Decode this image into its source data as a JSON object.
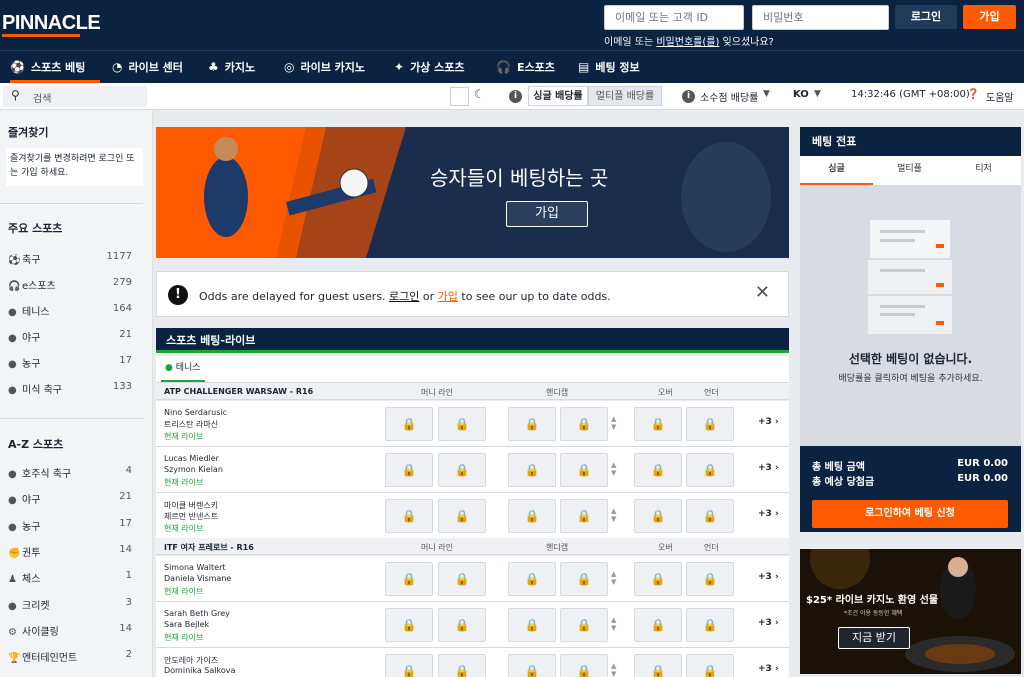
{
  "header": {
    "logo": "PINNACLE",
    "email_placeholder": "이메일 또는 고객 ID",
    "password_placeholder": "비밀번호",
    "login": "로그인",
    "join": "가입",
    "forgot_prefix": "이메일 또는 ",
    "forgot_link": "비밀번호를(를)",
    "forgot_suffix": " 잊으셨나요?"
  },
  "nav": [
    {
      "label": "스포츠 베팅",
      "icon": "⚽"
    },
    {
      "label": "라이브 센터",
      "icon": "◔"
    },
    {
      "label": "카지노",
      "icon": "♣"
    },
    {
      "label": "라이브 카지노",
      "icon": "◎"
    },
    {
      "label": "가상 스포츠",
      "icon": "✦"
    },
    {
      "label": "E스포츠",
      "icon": "🎧"
    },
    {
      "label": "베팅 정보",
      "icon": "▤"
    }
  ],
  "subbar": {
    "search_placeholder": "검색",
    "single_odds": "싱글 배당률",
    "multi_odds": "멀티플 배당률",
    "decimal_odds": "소수점 배당률",
    "lang": "KO",
    "time": "14:32:46 (GMT +08:00)",
    "help": "도움말"
  },
  "sidebar": {
    "favorites_title": "즐겨찾기",
    "favorites_text": "즐겨찾기를 변경하려면 로그인 또는 가입 하세요.",
    "top_title": "주요 스포츠",
    "top": [
      {
        "label": "축구",
        "count": "1177",
        "icon": "⚽"
      },
      {
        "label": "e스포츠",
        "count": "279",
        "icon": "🎧"
      },
      {
        "label": "테니스",
        "count": "164",
        "icon": "●"
      },
      {
        "label": "야구",
        "count": "21",
        "icon": "●"
      },
      {
        "label": "농구",
        "count": "17",
        "icon": "●"
      },
      {
        "label": "미식 축구",
        "count": "133",
        "icon": "●"
      }
    ],
    "az_title": "A-Z 스포츠",
    "az": [
      {
        "label": "호주식 축구",
        "count": "4",
        "icon": "●"
      },
      {
        "label": "야구",
        "count": "21",
        "icon": "●"
      },
      {
        "label": "농구",
        "count": "17",
        "icon": "●"
      },
      {
        "label": "권투",
        "count": "14",
        "icon": "✊"
      },
      {
        "label": "체스",
        "count": "1",
        "icon": "♟"
      },
      {
        "label": "크리켓",
        "count": "3",
        "icon": "●"
      },
      {
        "label": "사이클링",
        "count": "14",
        "icon": "⚙"
      },
      {
        "label": "엔터테인먼트",
        "count": "2",
        "icon": "🏆"
      }
    ]
  },
  "banner": {
    "title": "승자들이 베팅하는 곳",
    "button": "가입"
  },
  "notice": {
    "pre": "Odds are delayed for guest users. ",
    "login": "로그인",
    "or": " or ",
    "join": "가입",
    "post": " to see our up to date odds."
  },
  "live": {
    "title": "스포츠 베팅-라이브",
    "tab": "테니스",
    "columns": [
      "머니 라인",
      "핸디캡",
      "오버",
      "언더"
    ],
    "leagues": [
      {
        "name": "ATP CHALLENGER WARSAW - R16"
      },
      {
        "name": "ITF 여자 프레로브 - R16"
      }
    ],
    "matches": [
      {
        "p1": "Nino Serdarusic",
        "p2": "트리스탄 라마신",
        "status": "현재 라이브",
        "more": "+3"
      },
      {
        "p1": "Lucas Miedler",
        "p2": "Szymon Kielan",
        "status": "현재 라이브",
        "more": "+3"
      },
      {
        "p1": "마이클 버렌스키",
        "p2": "체르먼 반넨스트",
        "status": "현재 라이브",
        "more": "+3"
      },
      {
        "p1": "Simona Waltert",
        "p2": "Daniela Vismane",
        "status": "현재 라이브",
        "more": "+3"
      },
      {
        "p1": "Sarah Beth Grey",
        "p2": "Sara Bejlek",
        "status": "현재 라이브",
        "more": "+3"
      },
      {
        "p1": "안도레아 가이즈",
        "p2": "Dominika Salkova",
        "status": "",
        "more": "+3"
      }
    ]
  },
  "slip": {
    "title": "베팅 전표",
    "tabs": [
      "싱글",
      "멀티플",
      "티저"
    ],
    "empty_title": "선택한 베팅이 없습니다.",
    "empty_sub": "배당률을 클릭하여 베팅을 추가하세요.",
    "total_stake_label": "총 베팅 금액",
    "total_stake": "EUR 0.00",
    "total_win_label": "총 예상 당첨금",
    "total_win": "EUR 0.00",
    "submit": "로그인하여 베팅 신청"
  },
  "casino": {
    "title": "$25* 라이브 카지노 환영 선물",
    "sub": "*조건 이용 동등한 혜택",
    "button": "지금 받기"
  },
  "colors": {
    "navy": "#0b2240",
    "orange": "#ff5a00",
    "green": "#1ea33a"
  }
}
